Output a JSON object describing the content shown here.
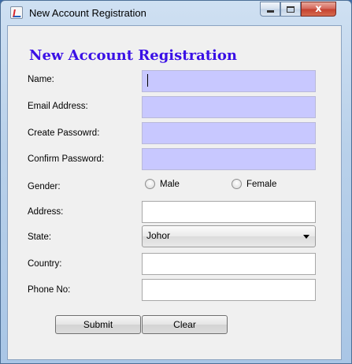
{
  "window": {
    "title": "New Account Registration",
    "close_glyph": "x"
  },
  "form": {
    "heading": "New Account Registration",
    "labels": {
      "name": "Name:",
      "email": "Email Address:",
      "create_password": "Create Passowrd:",
      "confirm_password": "Confirm Password:",
      "gender": "Gender:",
      "address": "Address:",
      "state": "State:",
      "country": "Country:",
      "phone": "Phone No:"
    },
    "values": {
      "name": "",
      "email": "",
      "create_password": "",
      "confirm_password": "",
      "address": "",
      "country": "",
      "phone": ""
    },
    "gender_options": [
      "Male",
      "Female"
    ],
    "state_selected": "Johor",
    "buttons": {
      "submit": "Submit",
      "clear": "Clear"
    }
  },
  "colors": {
    "heading": "#3a10e6",
    "highlight_field": "#c8c8ff"
  }
}
